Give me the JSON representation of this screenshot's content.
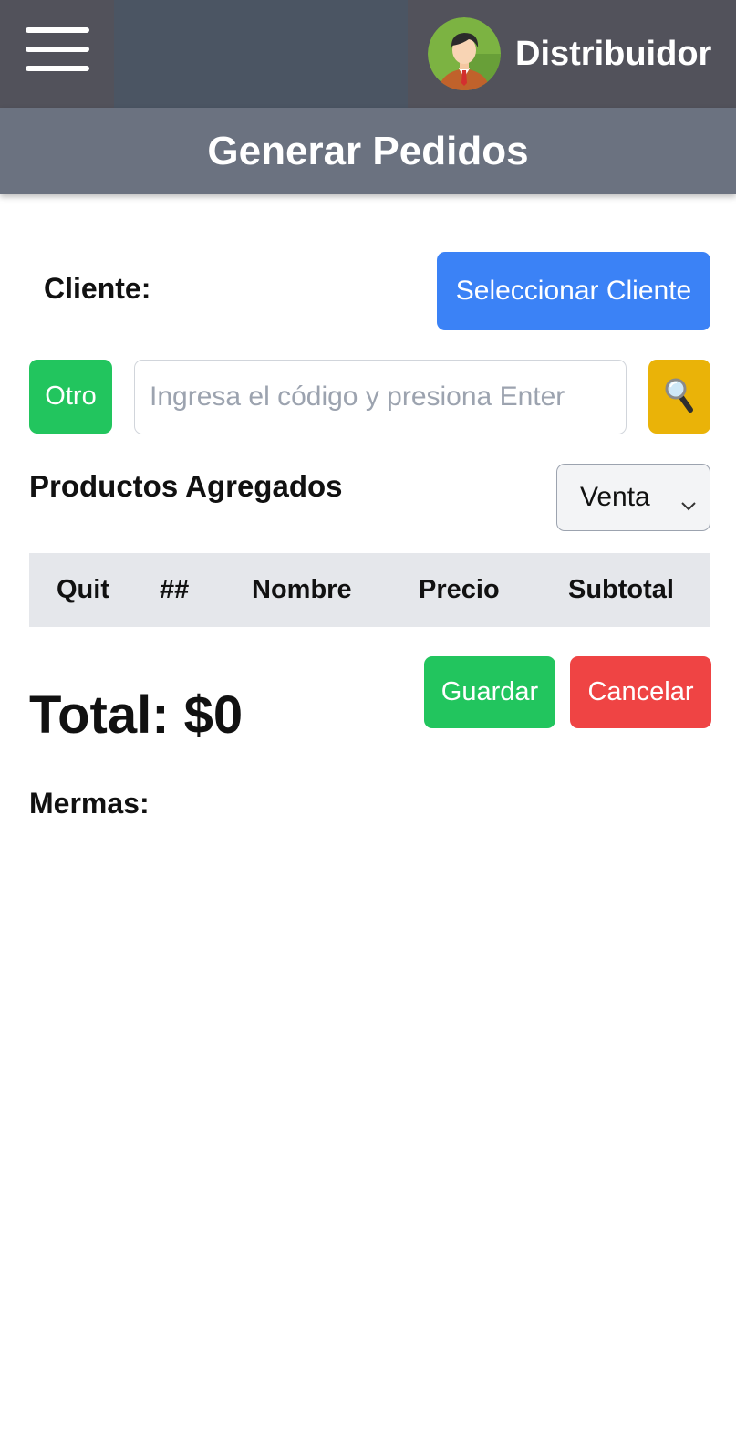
{
  "header": {
    "menu_icon": "hamburger-icon",
    "user_role": "Distribuidor",
    "avatar_icon": "user-avatar-icon"
  },
  "page": {
    "title": "Generar Pedidos"
  },
  "client": {
    "label": "Cliente:",
    "select_button": "Seleccionar Cliente"
  },
  "search": {
    "other_button": "Otro",
    "placeholder": "Ingresa el código y presiona Enter",
    "value": "",
    "search_icon": "magnifier-icon"
  },
  "products": {
    "title": "Productos Agregados",
    "type_selected": "Venta",
    "columns": [
      "Quit",
      "##",
      "Nombre",
      "Precio",
      "Subtotal"
    ],
    "rows": []
  },
  "summary": {
    "total_text": "Total: $0",
    "save_button": "Guardar",
    "cancel_button": "Cancelar",
    "mermas_label": "Mermas:"
  },
  "colors": {
    "primary_blue": "#3b82f6",
    "success_green": "#22c55e",
    "danger_red": "#ef4444",
    "warning_yellow": "#eab308",
    "header_gray": "#52525b",
    "title_bar_gray": "#6b7280"
  }
}
